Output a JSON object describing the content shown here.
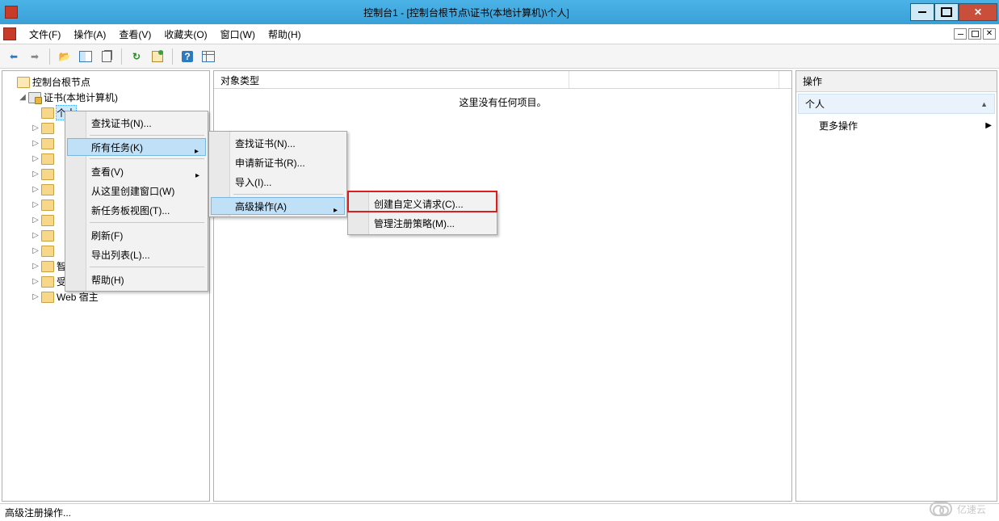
{
  "window": {
    "title": "控制台1 - [控制台根节点\\证书(本地计算机)\\个人]"
  },
  "menubar": {
    "items": [
      "文件(F)",
      "操作(A)",
      "查看(V)",
      "收藏夹(O)",
      "窗口(W)",
      "帮助(H)"
    ]
  },
  "tree": {
    "root": "控制台根节点",
    "cert_root": "证书(本地计算机)",
    "selected": "个人",
    "under_menu_last": "智能卡受信任的根",
    "trusted_devices": "受信任的设备",
    "web_host": "Web 宿主"
  },
  "center": {
    "columns": [
      "对象类型"
    ],
    "empty": "这里没有任何项目。"
  },
  "actions": {
    "title": "操作",
    "context": "个人",
    "more": "更多操作"
  },
  "context_menu_1": {
    "find": "查找证书(N)...",
    "all_tasks": "所有任务(K)",
    "view": "查看(V)",
    "new_window": "从这里创建窗口(W)",
    "new_taskpad": "新任务板视图(T)...",
    "refresh": "刷新(F)",
    "export": "导出列表(L)...",
    "help": "帮助(H)"
  },
  "context_menu_2": {
    "find": "查找证书(N)...",
    "request": "申请新证书(R)...",
    "import": "导入(I)...",
    "advanced": "高级操作(A)"
  },
  "context_menu_3": {
    "create_custom": "创建自定义请求(C)...",
    "manage_policies": "管理注册策略(M)..."
  },
  "statusbar": {
    "text": "高级注册操作..."
  },
  "watermark": {
    "text": "亿速云"
  }
}
